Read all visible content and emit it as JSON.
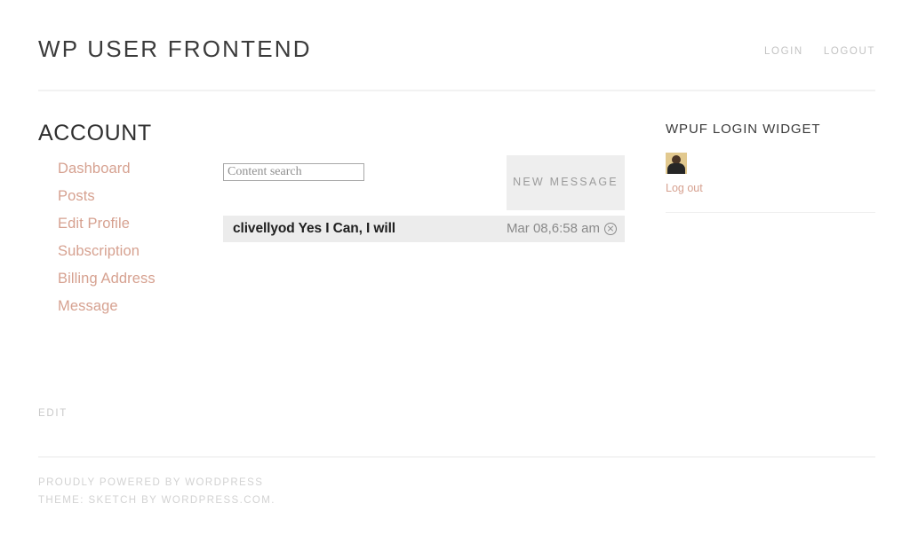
{
  "header": {
    "site_title": "WP USER FRONTEND",
    "nav": [
      {
        "label": "LOGIN",
        "name": "nav-login"
      },
      {
        "label": "LOGOUT",
        "name": "nav-logout"
      }
    ]
  },
  "main": {
    "page_title": "ACCOUNT",
    "account_nav": [
      {
        "label": "Dashboard"
      },
      {
        "label": "Posts"
      },
      {
        "label": "Edit Profile"
      },
      {
        "label": "Subscription"
      },
      {
        "label": "Billing Address"
      },
      {
        "label": "Message"
      }
    ],
    "search": {
      "placeholder": "Content search",
      "value": ""
    },
    "new_message_button": "NEW MESSAGE",
    "messages": [
      {
        "sender": "clivellyod",
        "preview": "Yes I Can, I will",
        "text": "clivellyod Yes I Can, I will",
        "date": "Mar 08,6:58 am",
        "delete_icon": "circle-x-icon",
        "delete_glyph": "×"
      }
    ],
    "edit_link": "EDIT"
  },
  "widget": {
    "title": "WPUF LOGIN WIDGET",
    "avatar_alt": "user-avatar",
    "logout_label": "Log out"
  },
  "footer": {
    "lines": [
      "PROUDLY POWERED BY WORDPRESS",
      "THEME: SKETCH BY WORDPRESS.COM."
    ]
  },
  "colors": {
    "accent_link": "#d6a190",
    "muted_text": "#c3c3c3",
    "row_background": "#ececec",
    "button_background": "#eeeeee"
  }
}
